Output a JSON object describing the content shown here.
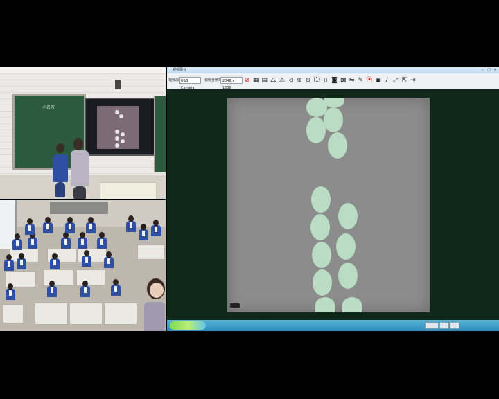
{
  "app": {
    "title": "视频展台",
    "win_buttons": [
      "–",
      "□",
      "✕"
    ]
  },
  "toolbar": {
    "device_label": "视频源",
    "device_value": "USB Camera",
    "resolution_label": "视频分辨率",
    "resolution_value": "2048 x 1536",
    "tools": [
      {
        "name": "stop-icon",
        "glyph": "⊘",
        "red": true
      },
      {
        "name": "grid-icon",
        "glyph": "▦"
      },
      {
        "name": "split-icon",
        "glyph": "▤"
      },
      {
        "name": "mirror-icon",
        "glyph": "⧋"
      },
      {
        "name": "warning-icon",
        "glyph": "⚠"
      },
      {
        "name": "speaker-icon",
        "glyph": "◁"
      },
      {
        "name": "zoom-in-icon",
        "glyph": "⊕"
      },
      {
        "name": "zoom-out-icon",
        "glyph": "⊖"
      },
      {
        "name": "actual-size-icon",
        "glyph": "⑴"
      },
      {
        "name": "fit-icon",
        "glyph": "▯"
      },
      {
        "name": "camera-icon",
        "glyph": "◙"
      },
      {
        "name": "batch-icon",
        "glyph": "▩"
      },
      {
        "name": "compare-icon",
        "glyph": "⇋"
      },
      {
        "name": "draw-icon",
        "glyph": "✎"
      },
      {
        "name": "record-icon",
        "glyph": "⦿",
        "red": true
      },
      {
        "name": "board-icon",
        "glyph": "▣"
      },
      {
        "name": "pen-icon",
        "glyph": "∕"
      },
      {
        "name": "fullscreen-icon",
        "glyph": "⤢"
      },
      {
        "name": "export-icon",
        "glyph": "⇱"
      },
      {
        "name": "exit-icon",
        "glyph": "⇥"
      }
    ]
  },
  "taskbar": {
    "tray_items": [
      "",
      "",
      ""
    ],
    "clock": ""
  },
  "left_feeds": {
    "top_board_text": "小名写"
  },
  "colors": {
    "paper": "#8c8c8c",
    "circle": "#b9dcc3",
    "viewport_bg": "#10281a"
  }
}
